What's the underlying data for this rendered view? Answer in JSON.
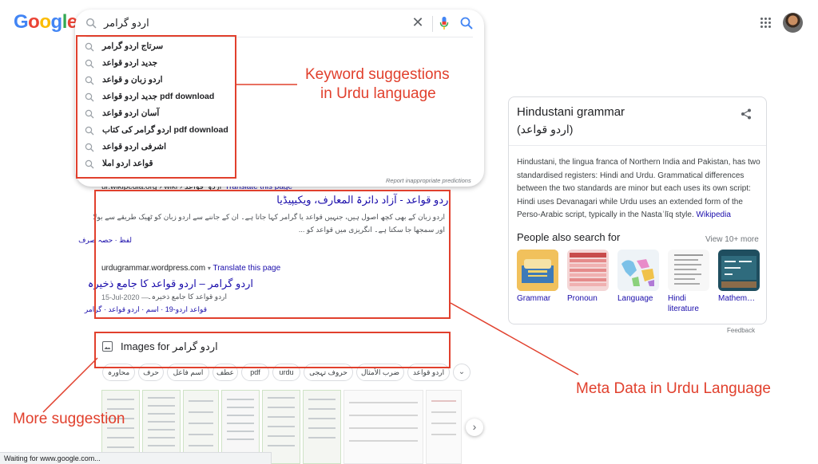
{
  "logo": {
    "letters": [
      "G",
      "o",
      "o",
      "g",
      "l",
      "e"
    ],
    "colors": [
      "#4285F4",
      "#EA4335",
      "#FBBC05",
      "#4285F4",
      "#34A853",
      "#EA4335"
    ]
  },
  "search": {
    "query": "اردو گرامر",
    "suggestions": [
      "سرتاج اردو گرامر",
      "جدید اردو قواعد",
      "اردو زبان و قواعد",
      "جدید اردو قواعد pdf download",
      "آسان اردو قواعد",
      "اردو گرامر کی کتاب pdf download",
      "اشرفی اردو قواعد",
      "قواعد اردو املا"
    ],
    "report": "Report inappropriate predictions"
  },
  "annotations": {
    "keyword": [
      "Keyword suggestions",
      "in Urdu language"
    ],
    "meta": "Meta Data in Urdu Language",
    "more": "More suggestion",
    "color": "#e1402d"
  },
  "results": {
    "partial_url": "ur.wikipedia.org › wiki › اردو_قواعد",
    "partial_translate": "Translate this page",
    "r1_title": "اردو قواعد - آزاد دائرۃ المعارف، ویکیپیڈیا",
    "r1_snippet_1": "اردو زبان کے بھی کچھ اصول ہیں، جنہیں قواعد یا گرامر کہا جاتا ہے۔ ان کے جاننے سے اردو زبان کو ٹھیک طریقے سے بولا",
    "r1_snippet_2": "اور سمجھا جا سکتا ہے۔ انگریزی میں قواعد کو ...",
    "r1_links": "لفظ · حصہ صرف",
    "r2_url": "urdugrammar.wordpress.com",
    "r2_translate": "Translate this page",
    "r2_title": "اردو گرامر – اردو قواعد کا جامع ذخیرہ",
    "r2_date": "15-Jul-2020 —",
    "r2_snippet": "اردو قواعد کا جامع ذخیرہ۔",
    "r2_links": "قواعد اردو-19 · اسم · اردو قواعد · گرامر"
  },
  "images": {
    "header_prefix": "Images for",
    "header_query": "اردو گرامر",
    "chips": [
      "محاورہ",
      "حرف",
      "اسم فاعل",
      "عطف",
      "pdf",
      "urdu",
      "حروف تہجی",
      "ضرب الأمثال",
      "اردو قواعد"
    ]
  },
  "knowledge_panel": {
    "title": "Hindustani grammar",
    "subtitle": "(اردو قواعد)",
    "description": "Hindustani, the lingua franca of Northern India and Pakistan, has two standardised registers: Hindi and Urdu. Grammatical differences between the two standards are minor but each uses its own script: Hindi uses Devanagari while Urdu uses an extended form of the Perso-Arabic script, typically in the Nastaʿlīq style.",
    "wiki_link": "Wikipedia",
    "people_also_search": "People also search for",
    "view_more": "View 10+ more",
    "items": [
      "Grammar",
      "Pronoun",
      "Language",
      "Hindi literature",
      "Mathem…"
    ],
    "feedback": "Feedback"
  },
  "status": "Waiting for www.google.com..."
}
